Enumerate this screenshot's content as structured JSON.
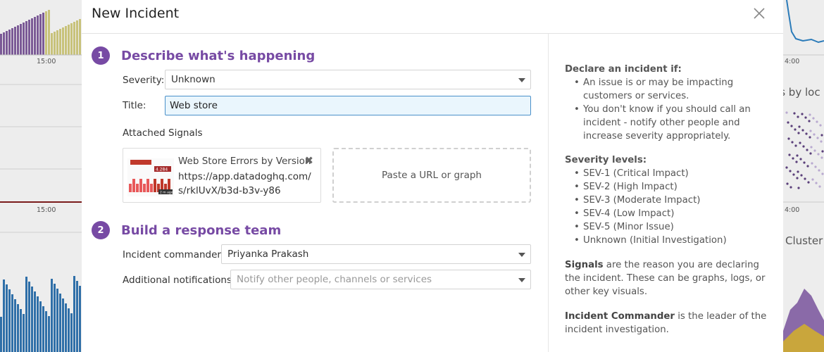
{
  "background": {
    "tick_left_top": "15:00",
    "tick_left_bottom": "15:00",
    "tick_right_top": "4:00",
    "tick_right_bottom": "4:00",
    "partial_text_1": "es by loc",
    "partial_text_2": "Cluster"
  },
  "modal": {
    "title": "New Incident",
    "close_icon": "close-icon",
    "accent_color": "#774aa4"
  },
  "step1": {
    "number": "1",
    "title": "Describe what's happening",
    "severity_label": "Severity:",
    "severity_value": "Unknown",
    "title_label": "Title:",
    "title_value": "Web store ",
    "attached_signals_label": "Attached Signals",
    "signal": {
      "title": "Web Store Errors by Version",
      "url": "https://app.datadoghq.com/s/rklUvX/b3d-b3v-y86",
      "thumb_badge_1": "4.284",
      "thumb_badge_2": "2 m ago"
    },
    "paste_placeholder": "Paste a URL or graph"
  },
  "step2": {
    "number": "2",
    "title": "Build a response team",
    "commander_label": "Incident commander:",
    "commander_value": "Priyanka Prakash",
    "notifications_label": "Additional notifications:",
    "notifications_placeholder": "Notify other people, channels or services"
  },
  "help": {
    "declare_heading": "Declare an incident if:",
    "declare_items": [
      "An issue is or may be impacting customers or services.",
      "You don't know if you should call an incident - notify other people and increase severity appropriately."
    ],
    "severity_heading": "Severity levels:",
    "severity_items": [
      "SEV-1 (Critical Impact)",
      "SEV-2 (High Impact)",
      "SEV-3 (Moderate Impact)",
      "SEV-4 (Low Impact)",
      "SEV-5 (Minor Issue)",
      "Unknown (Initial Investigation)"
    ],
    "signals_bold": "Signals",
    "signals_text": " are the reason you are declaring the incident. These can be graphs, logs, or other key visuals.",
    "commander_bold": "Incident Commander",
    "commander_text": " is the leader of the incident investigation."
  }
}
